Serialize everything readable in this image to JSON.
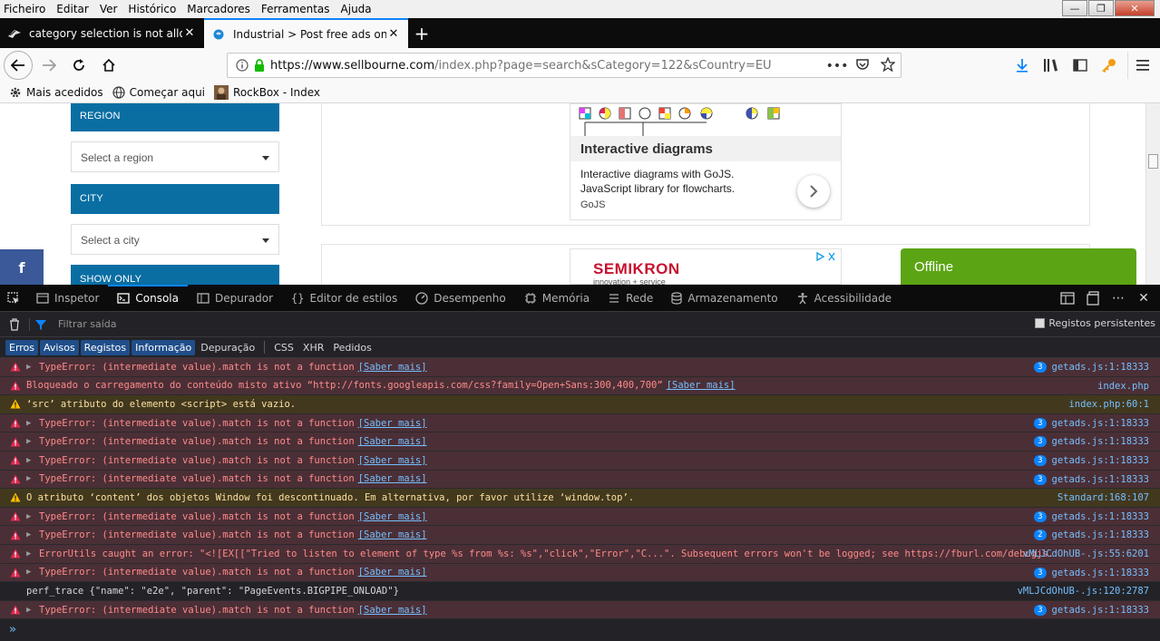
{
  "menubar": {
    "items": [
      "Ficheiro",
      "Editar",
      "Ver",
      "Histórico",
      "Marcadores",
      "Ferramentas",
      "Ajuda"
    ]
  },
  "window_controls": {
    "minimize": "—",
    "restore": "❐",
    "close": "✕"
  },
  "tabs": [
    {
      "title": "category selection is not allowe",
      "close": "✕",
      "active": false
    },
    {
      "title": "Industrial > Post free ads online",
      "close": "✕",
      "active": true
    }
  ],
  "newtab_label": "+",
  "navbar": {
    "url_domain": "https://www.sellbourne.com",
    "url_path": "/index.php?page=search&sCategory=122&sCountry=EU",
    "more_label": "•••"
  },
  "bookmarks": [
    {
      "label": "Mais acedidos",
      "icon": "gear-icon"
    },
    {
      "label": "Começar aqui",
      "icon": "globe-icon"
    },
    {
      "label": "RockBox - Index",
      "icon": "rockbox-icon"
    }
  ],
  "page": {
    "region_header": "REGION",
    "region_select": "Select a region",
    "city_header": "CITY",
    "city_select": "Select a city",
    "show_header": "SHOW ONLY",
    "fb_label": "f",
    "ad_title": "Interactive diagrams",
    "ad_desc": "Interactive diagrams with GoJS. JavaScript library for flowcharts.",
    "ad_source": "GoJS",
    "semikron_logo": "SEMIKRON",
    "semikron_tag": "innovation + service",
    "offline_label": "Offline"
  },
  "devtools": {
    "tabs": [
      {
        "label": "Inspetor",
        "icon": "inspector-icon",
        "active": false
      },
      {
        "label": "Consola",
        "icon": "console-icon",
        "active": true
      },
      {
        "label": "Depurador",
        "icon": "debugger-icon",
        "active": false
      },
      {
        "label": "Editor de estilos",
        "icon": "style-editor-icon",
        "active": false
      },
      {
        "label": "Desempenho",
        "icon": "performance-icon",
        "active": false
      },
      {
        "label": "Memória",
        "icon": "memory-icon",
        "active": false
      },
      {
        "label": "Rede",
        "icon": "network-icon",
        "active": false
      },
      {
        "label": "Armazenamento",
        "icon": "storage-icon",
        "active": false
      },
      {
        "label": "Acessibilidade",
        "icon": "accessibility-icon",
        "active": false
      }
    ],
    "filter_placeholder": "Filtrar saída",
    "persist_label": "Registos persistentes",
    "categories": [
      {
        "label": "Erros",
        "on": true
      },
      {
        "label": "Avisos",
        "on": true
      },
      {
        "label": "Registos",
        "on": true
      },
      {
        "label": "Informação",
        "on": true
      },
      {
        "label": "Depuração",
        "on": false
      },
      {
        "label": "CSS",
        "on": false
      },
      {
        "label": "XHR",
        "on": false
      },
      {
        "label": "Pedidos",
        "on": false
      }
    ],
    "messages": [
      {
        "level": "err",
        "twisty": true,
        "text": "TypeError: (intermediate value).match is not a function",
        "link": "[Saber mais]",
        "count": "3",
        "source": "getads.js:1:18333"
      },
      {
        "level": "err",
        "twisty": false,
        "text": "Bloqueado o carregamento do conteúdo misto ativo “http://fonts.googleapis.com/css?family=Open+Sans:300,400,700”",
        "link": "[Saber mais]",
        "count": "",
        "source": "index.php"
      },
      {
        "level": "warn",
        "twisty": false,
        "text": "‘src’ atributo do elemento <script> está vazio.",
        "link": "",
        "count": "",
        "source": "index.php:60:1"
      },
      {
        "level": "err",
        "twisty": true,
        "text": "TypeError: (intermediate value).match is not a function",
        "link": "[Saber mais]",
        "count": "3",
        "source": "getads.js:1:18333"
      },
      {
        "level": "err",
        "twisty": true,
        "text": "TypeError: (intermediate value).match is not a function",
        "link": "[Saber mais]",
        "count": "3",
        "source": "getads.js:1:18333"
      },
      {
        "level": "err",
        "twisty": true,
        "text": "TypeError: (intermediate value).match is not a function",
        "link": "[Saber mais]",
        "count": "3",
        "source": "getads.js:1:18333"
      },
      {
        "level": "err",
        "twisty": true,
        "text": "TypeError: (intermediate value).match is not a function",
        "link": "[Saber mais]",
        "count": "3",
        "source": "getads.js:1:18333"
      },
      {
        "level": "warn",
        "twisty": false,
        "text": "O atributo ‘content’ dos objetos Window foi descontinuado.  Em alternativa, por favor utilize ‘window.top’.",
        "link": "",
        "count": "",
        "source": "Standard:168:107"
      },
      {
        "level": "err",
        "twisty": true,
        "text": "TypeError: (intermediate value).match is not a function",
        "link": "[Saber mais]",
        "count": "3",
        "source": "getads.js:1:18333"
      },
      {
        "level": "err",
        "twisty": true,
        "text": "TypeError: (intermediate value).match is not a function",
        "link": "[Saber mais]",
        "count": "2",
        "source": "getads.js:1:18333"
      },
      {
        "level": "err",
        "twisty": true,
        "text": "ErrorUtils caught an error: \"<![EX[[\"Tried to listen to element of type %s from %s: %s\",\"click\",\"Error\",\"C...\". Subsequent errors won't be logged; see https://fburl.com/debugjs.",
        "link": "",
        "count": "",
        "source": "vMLJCdOhUB-.js:55:6201"
      },
      {
        "level": "err",
        "twisty": true,
        "text": "TypeError: (intermediate value).match is not a function",
        "link": "[Saber mais]",
        "count": "3",
        "source": "getads.js:1:18333"
      },
      {
        "level": "log",
        "twisty": false,
        "text": "perf_trace {\"name\": \"e2e\", \"parent\": \"PageEvents.BIGPIPE_ONLOAD\"}",
        "link": "",
        "count": "",
        "source": "vMLJCdOhUB-.js:120:2787"
      },
      {
        "level": "err",
        "twisty": true,
        "text": "TypeError: (intermediate value).match is not a function",
        "link": "[Saber mais]",
        "count": "3",
        "source": "getads.js:1:18333"
      }
    ],
    "prompt": "»"
  }
}
